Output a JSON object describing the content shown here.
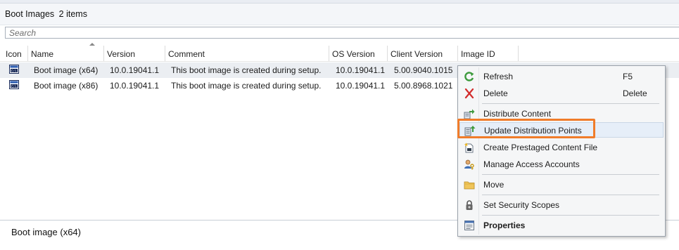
{
  "header": {
    "title": "Boot Images",
    "count": "2 items"
  },
  "search": {
    "placeholder": "Search"
  },
  "columns": [
    "Icon",
    "Name",
    "Version",
    "Comment",
    "OS Version",
    "Client Version",
    "Image ID"
  ],
  "rows": [
    {
      "name": "Boot image (x64)",
      "version": "10.0.19041.1",
      "comment": "This boot image is created during setup.",
      "os_version": "10.0.19041.1",
      "client_version": "5.00.9040.1015",
      "selected": true
    },
    {
      "name": "Boot image (x86)",
      "version": "10.0.19041.1",
      "comment": "This boot image is created during setup.",
      "os_version": "10.0.19041.1",
      "client_version": "5.00.8968.1021",
      "selected": false
    }
  ],
  "details": {
    "title": "Boot image (x64)"
  },
  "context_menu": {
    "refresh": {
      "label": "Refresh",
      "shortcut": "F5",
      "icon": "refresh-icon"
    },
    "delete": {
      "label": "Delete",
      "shortcut": "Delete",
      "icon": "delete-icon"
    },
    "distribute": {
      "label": "Distribute Content",
      "icon": "distribute-content-icon"
    },
    "update_dp": {
      "label": "Update Distribution Points",
      "icon": "update-distribution-points-icon"
    },
    "prestaged": {
      "label": "Create Prestaged Content File",
      "icon": "prestaged-content-icon"
    },
    "access": {
      "label": "Manage Access Accounts",
      "icon": "access-accounts-icon"
    },
    "move": {
      "label": "Move",
      "icon": "folder-icon"
    },
    "scopes": {
      "label": "Set Security Scopes",
      "icon": "lock-icon"
    },
    "properties": {
      "label": "Properties",
      "icon": "properties-icon"
    }
  },
  "colors": {
    "highlight": "#f07c2a",
    "selected_row": "#ebeef2",
    "menu_bg": "#f5f6f7"
  }
}
